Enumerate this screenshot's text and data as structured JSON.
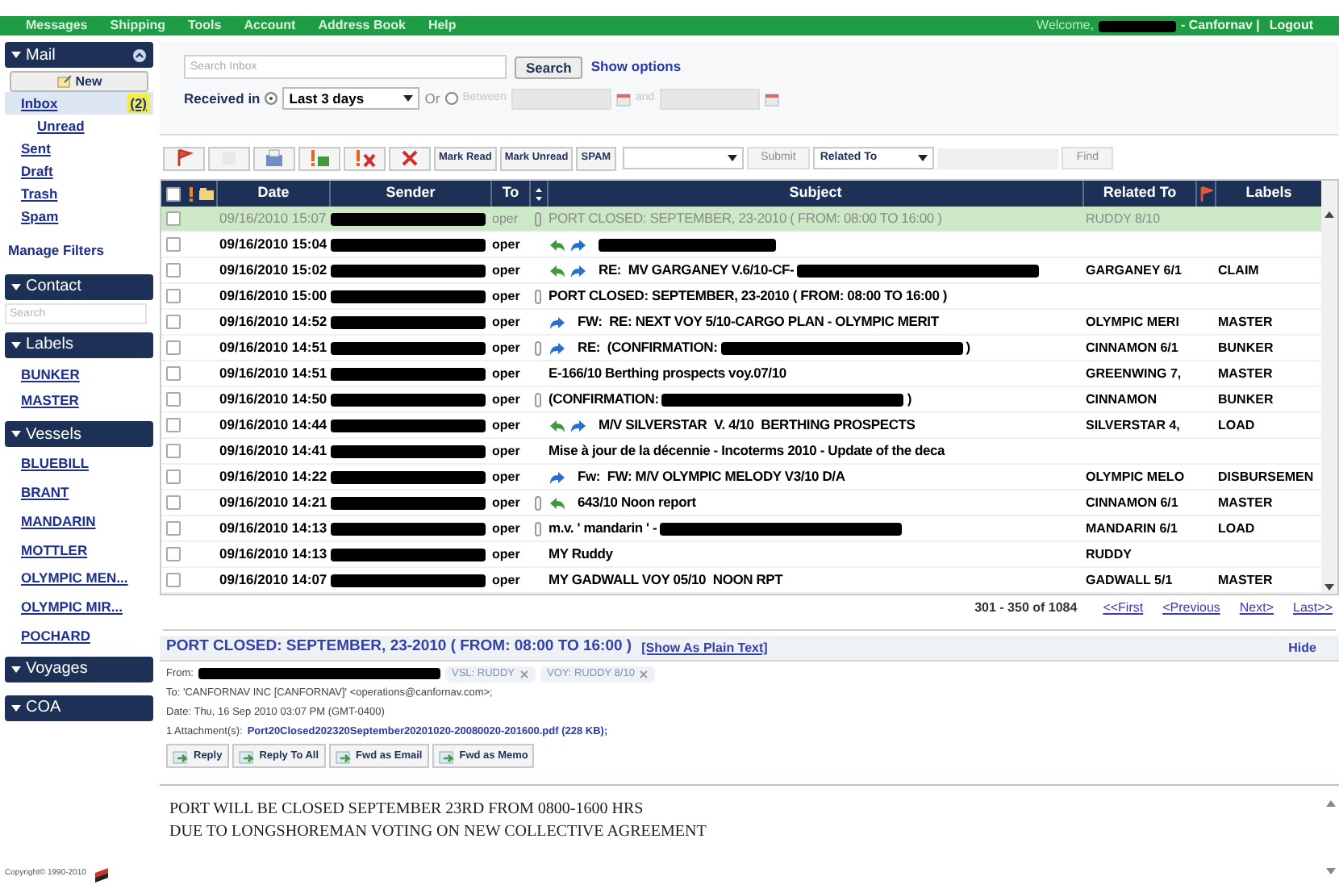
{
  "top_nav": {
    "items": [
      "Messages",
      "Shipping",
      "Tools",
      "Account",
      "Address Book",
      "Help"
    ],
    "welcome": "Welcome,",
    "user_redacted": true,
    "account": "- Canfornav |",
    "logout": "Logout"
  },
  "sidebar": {
    "mail": {
      "title": "Mail",
      "new_button": "New",
      "folders": [
        {
          "label": "Inbox",
          "badge": "(2)",
          "selected": true,
          "children": [
            {
              "label": "Unread",
              "selected": false
            }
          ]
        },
        {
          "label": "Sent",
          "selected": false
        },
        {
          "label": "Draft",
          "selected": false
        },
        {
          "label": "Trash",
          "selected": false
        },
        {
          "label": "Spam",
          "selected": false
        }
      ],
      "manage_filters": "Manage Filters"
    },
    "contact": {
      "title": "Contact",
      "search_placeholder": "Search"
    },
    "labels": {
      "title": "Labels",
      "items": [
        "BUNKER",
        "MASTER"
      ]
    },
    "vessels": {
      "title": "Vessels",
      "items": [
        "BLUEBILL",
        "BRANT",
        "MANDARIN",
        "MOTTLER",
        "OLYMPIC MEN...",
        "OLYMPIC MIR...",
        "POCHARD"
      ]
    },
    "voyages": {
      "title": "Voyages"
    },
    "coa": {
      "title": "COA"
    },
    "copyright": "Copyright© 1990-2010"
  },
  "search": {
    "placeholder": "Search Inbox",
    "button": "Search",
    "options_link": "Show options",
    "received_label": "Received in",
    "received_selected": true,
    "range": "Last 3 days",
    "or_label": "Or",
    "between_selected": false,
    "between_label": "Between",
    "and_label": "and"
  },
  "toolbar": {
    "icon_buttons": [
      {
        "kind": "flag"
      },
      {
        "kind": "blank"
      },
      {
        "kind": "move"
      },
      {
        "kind": "important"
      },
      {
        "kind": "unimportant"
      },
      {
        "kind": "delete"
      }
    ],
    "text_buttons": [
      "Mark Read",
      "Mark Unread",
      "SPAM"
    ],
    "label_button": {
      "label": "Submit",
      "disabled": true
    },
    "related_select": "Related To",
    "find_button": {
      "label": "Find",
      "disabled": true
    }
  },
  "table": {
    "all_checked": false,
    "columns": [
      "Date",
      "Sender",
      "To",
      "Subject",
      "Related To",
      "Labels"
    ],
    "rows": [
      {
        "checked": false,
        "date": "09/16/2010 15:07",
        "sender_redacted": true,
        "to": "oper",
        "attachment": true,
        "replied": false,
        "forwarded": false,
        "subject": "PORT CLOSED: SEPTEMBER, 23-2010 ( FROM: 08:00 TO 16:00 )",
        "related": "RUDDY 8/10",
        "unread": false,
        "selected": true
      },
      {
        "checked": false,
        "date": "09/16/2010 15:04",
        "sender_redacted": true,
        "to": "oper",
        "attachment": false,
        "replied": true,
        "forwarded": true,
        "subject_redacted": true,
        "unread": true,
        "selected": false
      },
      {
        "checked": false,
        "date": "09/16/2010 15:02",
        "sender_redacted": true,
        "to": "oper",
        "attachment": false,
        "replied": true,
        "forwarded": true,
        "subject": "RE:  MV GARGANEY V.6/10-CF-",
        "subject_redacted": true,
        "related": "GARGANEY 6/1",
        "labels": "CLAIM",
        "unread": true,
        "selected": false
      },
      {
        "checked": false,
        "date": "09/16/2010 15:00",
        "sender_redacted": true,
        "to": "oper",
        "attachment": true,
        "replied": false,
        "forwarded": false,
        "subject": "PORT CLOSED: SEPTEMBER, 23-2010 ( FROM: 08:00 TO 16:00 )",
        "unread": true,
        "selected": false
      },
      {
        "checked": false,
        "date": "09/16/2010 14:52",
        "sender_redacted": true,
        "to": "oper",
        "attachment": false,
        "replied": false,
        "forwarded": true,
        "subject": "FW:  RE: NEXT VOY 5/10-CARGO PLAN - OLYMPIC MERIT",
        "related": "OLYMPIC MERI",
        "labels": "MASTER",
        "unread": true,
        "selected": false
      },
      {
        "checked": false,
        "date": "09/16/2010 14:51",
        "sender_redacted": true,
        "to": "oper",
        "attachment": true,
        "replied": false,
        "forwarded": true,
        "subject": "RE:  (CONFIRMATION:",
        "subject_redacted": true,
        "subject_end": ")",
        "related": "CINNAMON 6/1",
        "labels": "BUNKER",
        "unread": true,
        "selected": false
      },
      {
        "checked": false,
        "date": "09/16/2010 14:51",
        "sender_redacted": true,
        "to": "oper",
        "attachment": false,
        "replied": false,
        "forwarded": false,
        "subject": "E-166/10 Berthing prospects voy.07/10",
        "related": "GREENWING 7,",
        "labels": "MASTER",
        "unread": true,
        "selected": false
      },
      {
        "checked": false,
        "date": "09/16/2010 14:50",
        "sender_redacted": true,
        "to": "oper",
        "attachment": true,
        "replied": false,
        "forwarded": false,
        "subject": "(CONFIRMATION:",
        "subject_redacted": true,
        "subject_end": ")",
        "related": "CINNAMON",
        "labels": "BUNKER",
        "unread": true,
        "selected": false
      },
      {
        "checked": false,
        "date": "09/16/2010 14:44",
        "sender_redacted": true,
        "to": "oper",
        "attachment": false,
        "replied": true,
        "forwarded": true,
        "subject": "M/V SILVERSTAR  V. 4/10  BERTHING PROSPECTS",
        "related": "SILVERSTAR 4,",
        "labels": "LOAD",
        "unread": true,
        "selected": false
      },
      {
        "checked": false,
        "date": "09/16/2010 14:41",
        "sender_redacted": true,
        "to": "oper",
        "attachment": false,
        "replied": false,
        "forwarded": false,
        "subject": "Mise à jour de la décennie - Incoterms 2010 - Update of the deca",
        "unread": true,
        "selected": false
      },
      {
        "checked": false,
        "date": "09/16/2010 14:22",
        "sender_redacted": true,
        "to": "oper",
        "attachment": false,
        "replied": false,
        "forwarded": true,
        "subject": "Fw:  FW: M/V OLYMPIC MELODY V3/10 D/A",
        "related": "OLYMPIC MELO",
        "labels": "DISBURSEMEN",
        "unread": true,
        "selected": false
      },
      {
        "checked": false,
        "date": "09/16/2010 14:21",
        "sender_redacted": true,
        "to": "oper",
        "attachment": true,
        "replied": true,
        "forwarded": false,
        "subject": "643/10 Noon report",
        "related": "CINNAMON 6/1",
        "labels": "MASTER",
        "unread": true,
        "selected": false
      },
      {
        "checked": false,
        "date": "09/16/2010 14:13",
        "sender_redacted": true,
        "to": "oper",
        "attachment": true,
        "replied": false,
        "forwarded": false,
        "subject": "m.v. ' mandarin ' -",
        "subject_redacted": true,
        "related": "MANDARIN 6/1",
        "labels": "LOAD",
        "unread": true,
        "selected": false
      },
      {
        "checked": false,
        "date": "09/16/2010 14:13",
        "sender_redacted": true,
        "to": "oper",
        "attachment": false,
        "replied": false,
        "forwarded": false,
        "subject": "MY Ruddy",
        "related": "RUDDY",
        "unread": true,
        "selected": false
      },
      {
        "checked": false,
        "date": "09/16/2010 14:07",
        "sender_redacted": true,
        "to": "oper",
        "attachment": false,
        "replied": false,
        "forwarded": false,
        "subject": "MY GADWALL VOY 05/10  NOON RPT",
        "related": "GADWALL 5/1",
        "labels": "MASTER",
        "unread": true,
        "selected": false
      }
    ]
  },
  "pager": {
    "range": "301 - 350 of 1084",
    "links": [
      "<<First",
      "<Previous",
      "Next>",
      "Last>>"
    ]
  },
  "preview": {
    "subject": "PORT CLOSED: SEPTEMBER, 23-2010 ( FROM: 08:00 TO 16:00 )",
    "plain_text_link": "[Show As Plain Text]",
    "hide": "Hide",
    "from_label": "From:",
    "from_redacted": true,
    "tags": [
      "VSL: RUDDY",
      "VOY: RUDDY 8/10"
    ],
    "to_line": "To: 'CANFORNAV INC [CANFORNAV]' <operations@canfornav.com>;",
    "date_line": "Date: Thu, 16 Sep 2010 03:07 PM (GMT-0400)",
    "attachments_label": "1 Attachment(s):",
    "attachment": "Port20Closed202320September20201020-20080020-201600.pdf (228 KB);",
    "buttons": [
      "Reply",
      "Reply To All",
      "Fwd as Email",
      "Fwd as Memo"
    ],
    "body": [
      "PORT WILL BE CLOSED SEPTEMBER 23RD FROM 0800-1600 HRS",
      "DUE TO LONGSHOREMAN VOTING ON NEW COLLECTIVE AGREEMENT"
    ]
  }
}
